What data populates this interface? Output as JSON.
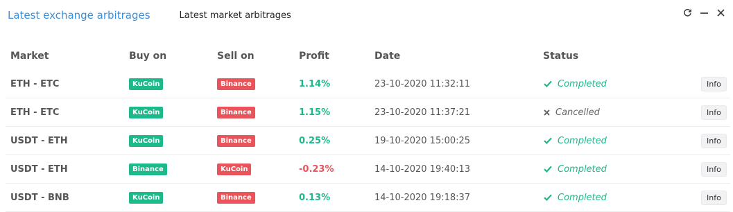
{
  "tabs": {
    "active": "Latest exchange arbitrages",
    "inactive": "Latest market arbitrages"
  },
  "window": {
    "refresh_icon": "refresh-icon",
    "minimize_icon": "minimize-icon",
    "close_icon": "close-icon"
  },
  "table": {
    "headers": {
      "market": "Market",
      "buy_on": "Buy on",
      "sell_on": "Sell on",
      "profit": "Profit",
      "date": "Date",
      "status": "Status"
    },
    "rows": [
      {
        "market": "ETH - ETC",
        "buy": "KuCoin",
        "buy_color": "#1cb98b",
        "sell": "Binance",
        "sell_color": "#e8545a",
        "profit": "1.14%",
        "profit_sign": "positive",
        "date": "23-10-2020 11:32:11",
        "status": "Completed",
        "status_icon": "check-icon",
        "action": "Info"
      },
      {
        "market": "ETH - ETC",
        "buy": "KuCoin",
        "buy_color": "#1cb98b",
        "sell": "Binance",
        "sell_color": "#e8545a",
        "profit": "1.15%",
        "profit_sign": "positive",
        "date": "23-10-2020 11:37:21",
        "status": "Cancelled",
        "status_icon": "x-icon",
        "action": "Info"
      },
      {
        "market": "USDT - ETH",
        "buy": "KuCoin",
        "buy_color": "#1cb98b",
        "sell": "Binance",
        "sell_color": "#e8545a",
        "profit": "0.25%",
        "profit_sign": "positive",
        "date": "19-10-2020 15:00:25",
        "status": "Completed",
        "status_icon": "check-icon",
        "action": "Info"
      },
      {
        "market": "USDT - ETH",
        "buy": "Binance",
        "buy_color": "#1cb98b",
        "sell": "KuCoin",
        "sell_color": "#e8545a",
        "profit": "-0.23%",
        "profit_sign": "negative",
        "date": "14-10-2020 19:40:13",
        "status": "Completed",
        "status_icon": "check-icon",
        "action": "Info"
      },
      {
        "market": "USDT - BNB",
        "buy": "KuCoin",
        "buy_color": "#1cb98b",
        "sell": "Binance",
        "sell_color": "#e8545a",
        "profit": "0.13%",
        "profit_sign": "positive",
        "date": "14-10-2020 19:18:37",
        "status": "Completed",
        "status_icon": "check-icon",
        "action": "Info"
      }
    ]
  },
  "colors": {
    "accent": "#3a8fd9",
    "positive": "#1cb98b",
    "negative": "#e8545a"
  }
}
